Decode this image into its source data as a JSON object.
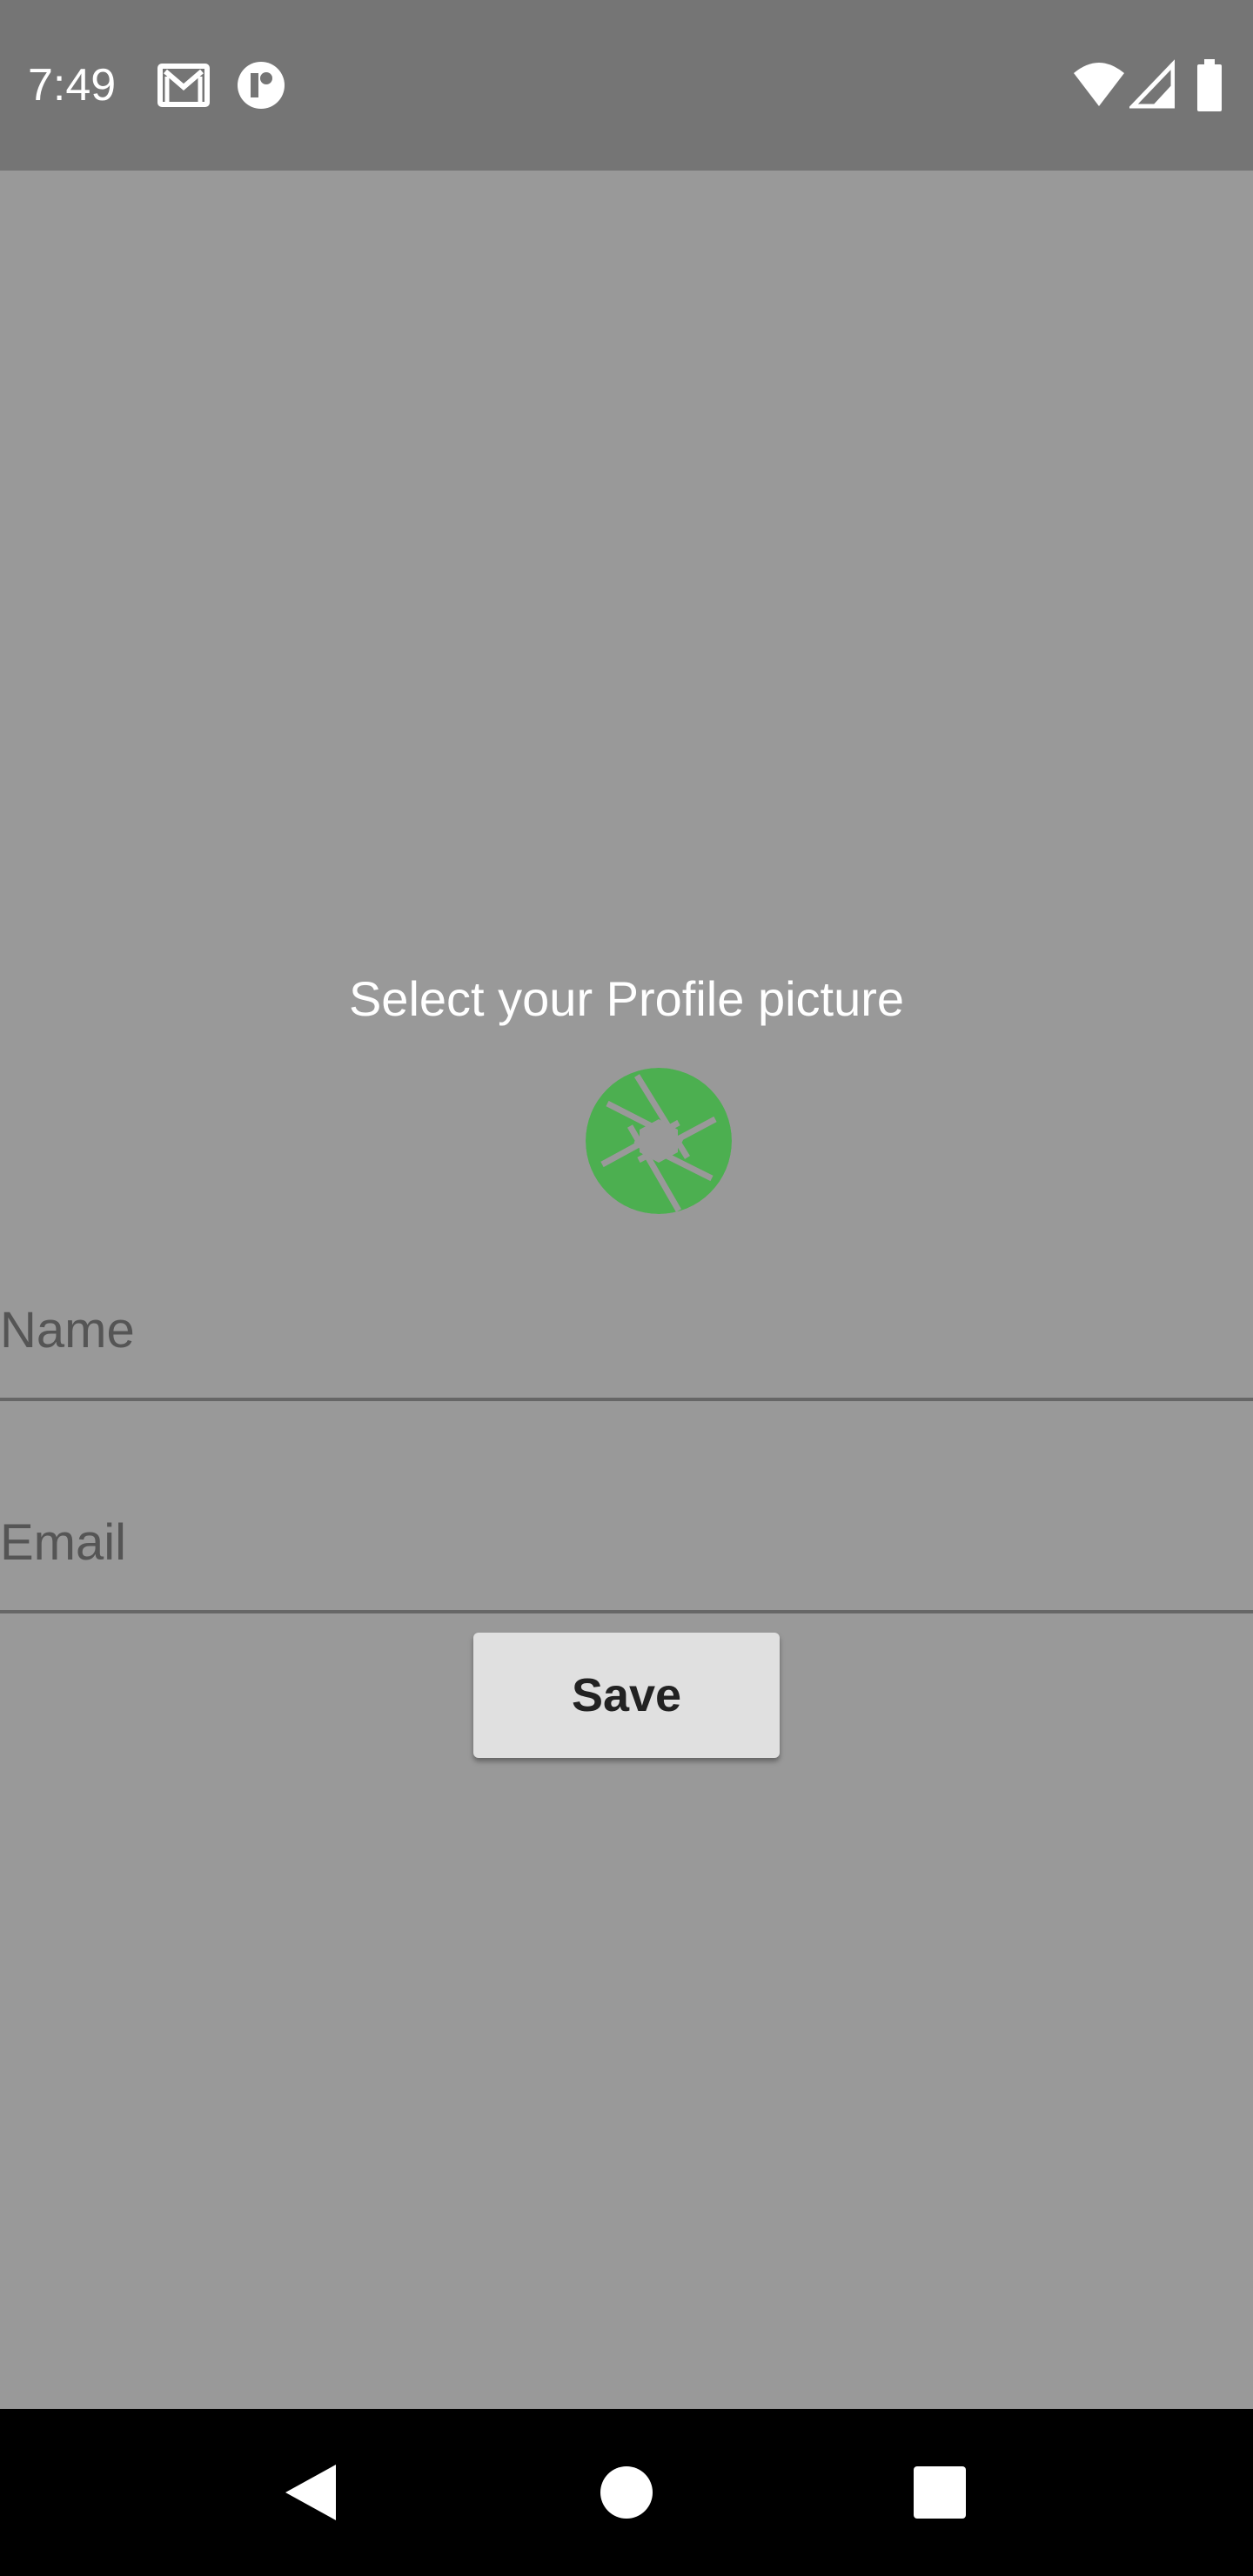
{
  "status_bar": {
    "time": "7:49",
    "icons_left": [
      "gmail-icon",
      "app-notification-icon"
    ],
    "icons_right": [
      "wifi-icon",
      "signal-icon",
      "battery-icon"
    ]
  },
  "profile": {
    "select_label": "Select your Profile picture",
    "camera_icon": "camera-shutter-icon",
    "accent_color": "#4caf50"
  },
  "form": {
    "name_placeholder": "Name",
    "name_value": "",
    "email_placeholder": "Email",
    "email_value": "",
    "save_label": "Save"
  },
  "nav_bar": {
    "buttons": [
      "back-icon",
      "home-icon",
      "recents-icon"
    ]
  },
  "colors": {
    "status_bar_bg": "#757575",
    "content_bg": "#999999",
    "nav_bar_bg": "#000000",
    "button_bg": "#e0e0e0"
  }
}
